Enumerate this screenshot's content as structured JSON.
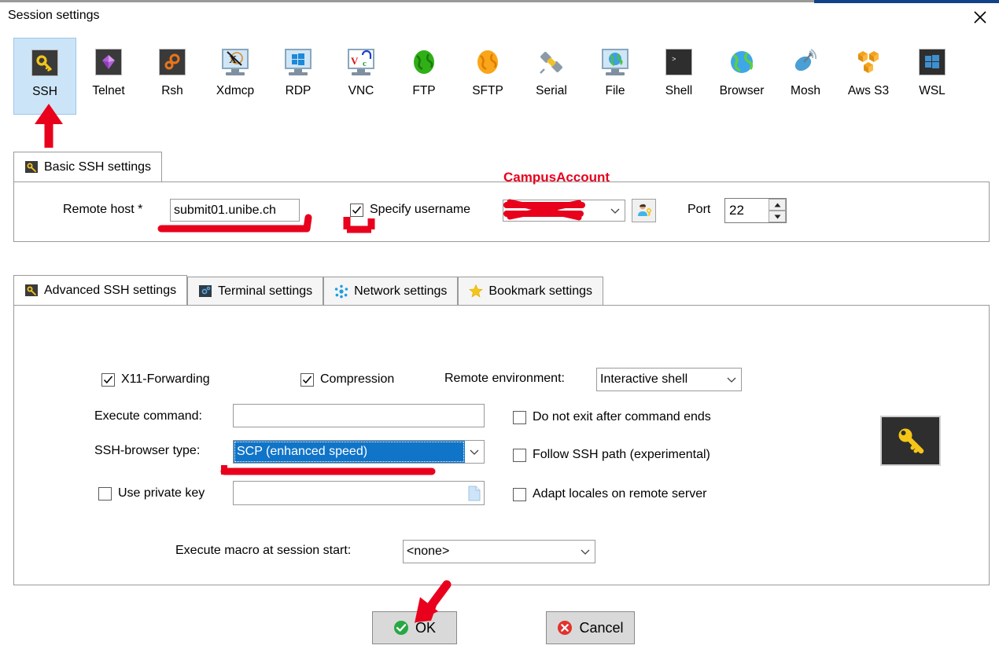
{
  "window": {
    "title": "Session settings",
    "close_icon": "close-icon"
  },
  "session_types": [
    {
      "label": "SSH",
      "icon": "ssh-key-icon",
      "selected": true
    },
    {
      "label": "Telnet",
      "icon": "telnet-gem-icon",
      "selected": false
    },
    {
      "label": "Rsh",
      "icon": "rsh-gears-icon",
      "selected": false
    },
    {
      "label": "Xdmcp",
      "icon": "xdmcp-x-icon",
      "selected": false
    },
    {
      "label": "RDP",
      "icon": "rdp-windows-icon",
      "selected": false
    },
    {
      "label": "VNC",
      "icon": "vnc-monitor-icon",
      "selected": false
    },
    {
      "label": "FTP",
      "icon": "ftp-globe-icon",
      "selected": false
    },
    {
      "label": "SFTP",
      "icon": "sftp-globe-icon",
      "selected": false
    },
    {
      "label": "Serial",
      "icon": "serial-plug-icon",
      "selected": false
    },
    {
      "label": "File",
      "icon": "file-monitor-icon",
      "selected": false
    },
    {
      "label": "Shell",
      "icon": "shell-prompt-icon",
      "selected": false
    },
    {
      "label": "Browser",
      "icon": "browser-globe-icon",
      "selected": false
    },
    {
      "label": "Mosh",
      "icon": "mosh-dish-icon",
      "selected": false
    },
    {
      "label": "Aws S3",
      "icon": "aws-s3-cubes-icon",
      "selected": false
    },
    {
      "label": "WSL",
      "icon": "wsl-windows-icon",
      "selected": false
    }
  ],
  "basic": {
    "tab_label": "Basic SSH settings",
    "tab_icon": "key-icon",
    "remote_host_label": "Remote host *",
    "remote_host_value": "submit01.unibe.ch",
    "specify_username_label": "Specify username",
    "specify_username_checked": true,
    "username_value": "",
    "username_redacted": true,
    "user_button_icon": "user-key-icon",
    "port_label": "Port",
    "port_value": "22"
  },
  "tabs": [
    {
      "label": "Advanced SSH settings",
      "icon": "key-icon",
      "active": true
    },
    {
      "label": "Terminal settings",
      "icon": "terminal-icon",
      "active": false
    },
    {
      "label": "Network settings",
      "icon": "network-icon",
      "active": false
    },
    {
      "label": "Bookmark settings",
      "icon": "star-icon",
      "active": false
    }
  ],
  "advanced": {
    "x11_label": "X11-Forwarding",
    "x11_checked": true,
    "compression_label": "Compression",
    "compression_checked": true,
    "remote_env_label": "Remote environment:",
    "remote_env_value": "Interactive shell",
    "execute_command_label": "Execute command:",
    "execute_command_value": "",
    "do_not_exit_label": "Do not exit after command ends",
    "do_not_exit_checked": false,
    "ssh_browser_label": "SSH-browser type:",
    "ssh_browser_value": "SCP (enhanced speed)",
    "follow_ssh_path_label": "Follow SSH path (experimental)",
    "follow_ssh_path_checked": false,
    "use_private_key_label": "Use private key",
    "use_private_key_checked": false,
    "private_key_value": "",
    "private_key_browse_icon": "file-page-icon",
    "adapt_locales_label": "Adapt locales on remote server",
    "adapt_locales_checked": false,
    "execute_macro_label": "Execute macro at session start:",
    "execute_macro_value": "<none>",
    "side_key_icon": "key-icon"
  },
  "buttons": {
    "ok_label": "OK",
    "ok_icon": "check-circle-icon",
    "cancel_label": "Cancel",
    "cancel_icon": "cancel-circle-icon"
  },
  "annotations": {
    "campus_account_text": "CampusAccount",
    "color": "#e8001c",
    "marks": [
      "arrow-up-to-ssh-icon",
      "underline-remote-host",
      "bracket-specify-username-checkbox",
      "scribble-over-username",
      "underline-ssh-browser-type",
      "arrow-down-to-ok-button"
    ]
  }
}
